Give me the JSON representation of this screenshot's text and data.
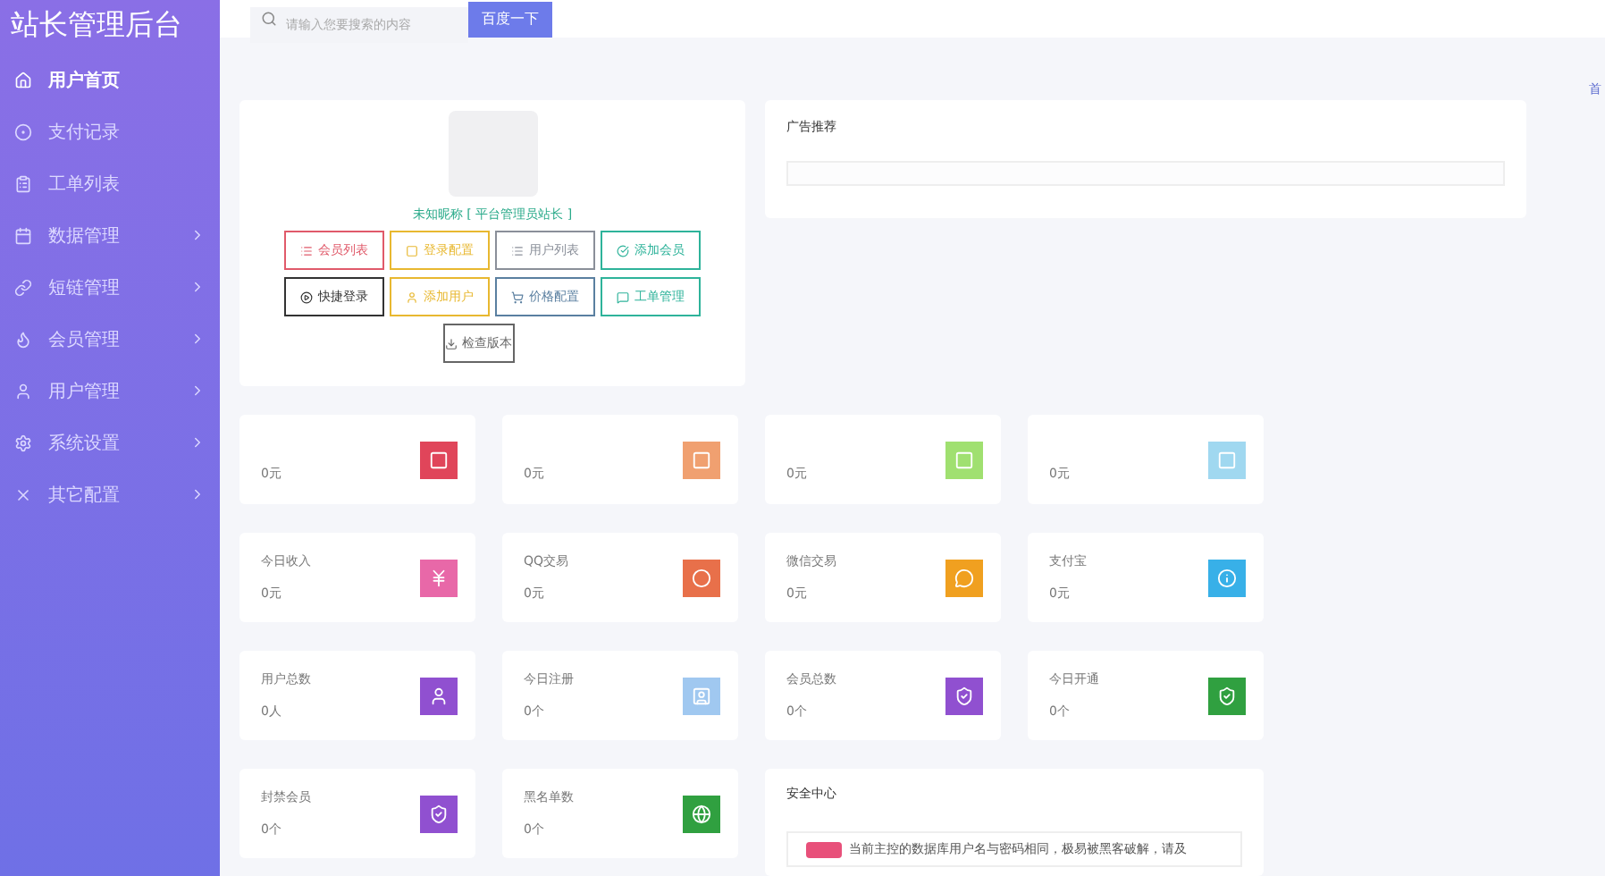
{
  "sidebar": {
    "title": "站长管理后台",
    "items": [
      {
        "label": "用户首页",
        "selected": true,
        "expandable": false
      },
      {
        "label": "支付记录",
        "selected": false,
        "expandable": false
      },
      {
        "label": "工单列表",
        "selected": false,
        "expandable": false
      },
      {
        "label": "数据管理",
        "selected": false,
        "expandable": true
      },
      {
        "label": "短链管理",
        "selected": false,
        "expandable": true
      },
      {
        "label": "会员管理",
        "selected": false,
        "expandable": true
      },
      {
        "label": "用户管理",
        "selected": false,
        "expandable": true
      },
      {
        "label": "系统设置",
        "selected": false,
        "expandable": true
      },
      {
        "label": "其它配置",
        "selected": false,
        "expandable": true
      }
    ]
  },
  "search": {
    "placeholder": "请输入您要搜索的内容",
    "button": "百度一下"
  },
  "top_right_link": "首",
  "profile": {
    "name": "未知昵称 [ 平台管理员站长 ]",
    "buttons": [
      {
        "label": "会员列表",
        "color": "#e05a6a"
      },
      {
        "label": "登录配置",
        "color": "#e8b830"
      },
      {
        "label": "用户列表",
        "color": "#8a8f99"
      },
      {
        "label": "添加会员",
        "color": "#2eb39a"
      },
      {
        "label": "快捷登录",
        "color": "#333333"
      },
      {
        "label": "添加用户",
        "color": "#e8b830"
      },
      {
        "label": "价格配置",
        "color": "#5a7fa0"
      },
      {
        "label": "工单管理",
        "color": "#2eb39a"
      },
      {
        "label": "检查版本",
        "color": "#666666"
      }
    ]
  },
  "ads": {
    "title": "广告推荐"
  },
  "stats": [
    {
      "value": "0元",
      "color": "#e0455a"
    },
    {
      "value": "0元",
      "color": "#f0a070"
    },
    {
      "value": "0元",
      "color": "#a0e070"
    },
    {
      "value": "0元",
      "color": "#a0d8f0"
    },
    {
      "label": "今日收入",
      "value": "0元",
      "color": "#e868a8"
    },
    {
      "label": "QQ交易",
      "value": "0元",
      "color": "#e8704a"
    },
    {
      "label": "微信交易",
      "value": "0元",
      "color": "#f0a020"
    },
    {
      "label": "支付宝",
      "value": "0元",
      "color": "#38b0e8"
    },
    {
      "label": "用户总数",
      "value": "0人",
      "color": "#9050d0"
    },
    {
      "label": "今日注册",
      "value": "0个",
      "color": "#a0c8f0"
    },
    {
      "label": "会员总数",
      "value": "0个",
      "color": "#9050d0"
    },
    {
      "label": "今日开通",
      "value": "0个",
      "color": "#30a040"
    },
    {
      "label": "封禁会员",
      "value": "0个",
      "color": "#9050d0"
    },
    {
      "label": "黑名单数",
      "value": "0个",
      "color": "#30a040"
    }
  ],
  "security": {
    "title": "安全中心",
    "message": "当前主控的数据库用户名与密码相同，极易被黑客破解，请及"
  }
}
